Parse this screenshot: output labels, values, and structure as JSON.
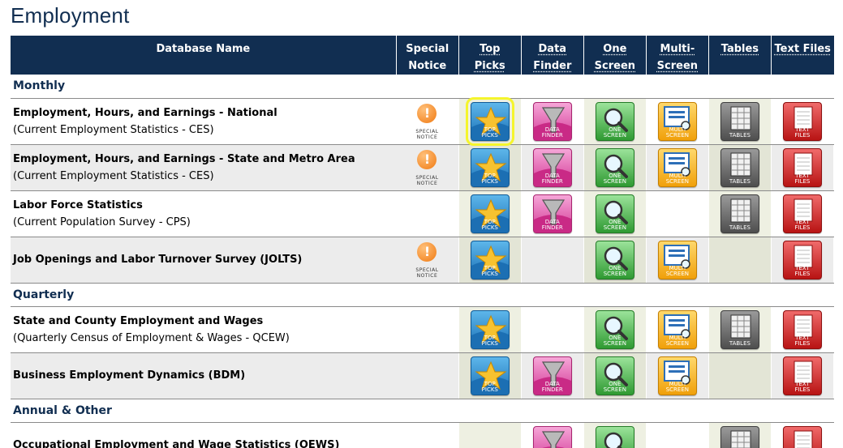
{
  "page": {
    "title": "Employment"
  },
  "columns": {
    "name": "Database Name",
    "special_notice": [
      "Special",
      "Notice"
    ],
    "top_picks": [
      "Top",
      "Picks"
    ],
    "data_finder": [
      "Data",
      "Finder"
    ],
    "one_screen": [
      "One",
      "Screen"
    ],
    "multi_screen": [
      "Multi-",
      "Screen"
    ],
    "tables": "Tables",
    "text_files": "Text Files"
  },
  "tiles": {
    "top": [
      "TOP",
      "PICKS"
    ],
    "data": [
      "DATA",
      "FINDER"
    ],
    "one": [
      "ONE",
      "SCREEN"
    ],
    "multi": [
      "MULTI",
      "SCREEN"
    ],
    "tables": [
      "TABLES"
    ],
    "text": [
      "TEXT",
      "FILES"
    ],
    "notice": [
      "SPECIAL",
      "NOTICE"
    ]
  },
  "colors": {
    "header_bg": "#112e51",
    "section_text": "#112e51",
    "highlight": "#f5f52c"
  },
  "sections": [
    {
      "label": "Monthly"
    },
    {
      "label": "Quarterly"
    },
    {
      "label": "Annual & Other"
    }
  ],
  "rows": [
    {
      "title": "Employment, Hours, and Earnings - National",
      "subtitle": "(Current Employment Statistics - CES)"
    },
    {
      "title": "Employment, Hours, and Earnings - State and Metro Area",
      "subtitle": "(Current Employment Statistics - CES)"
    },
    {
      "title": "Labor Force Statistics",
      "subtitle": "(Current Population Survey - CPS)"
    },
    {
      "title": "Job Openings and Labor Turnover Survey (JOLTS)",
      "subtitle": ""
    },
    {
      "title": "State and County Employment and Wages",
      "subtitle": "(Quarterly Census of Employment & Wages - QCEW)"
    },
    {
      "title": "Business Employment Dynamics (BDM)",
      "subtitle": ""
    },
    {
      "title": "Occupational Employment and Wage Statistics (OEWS)",
      "subtitle": ""
    }
  ]
}
